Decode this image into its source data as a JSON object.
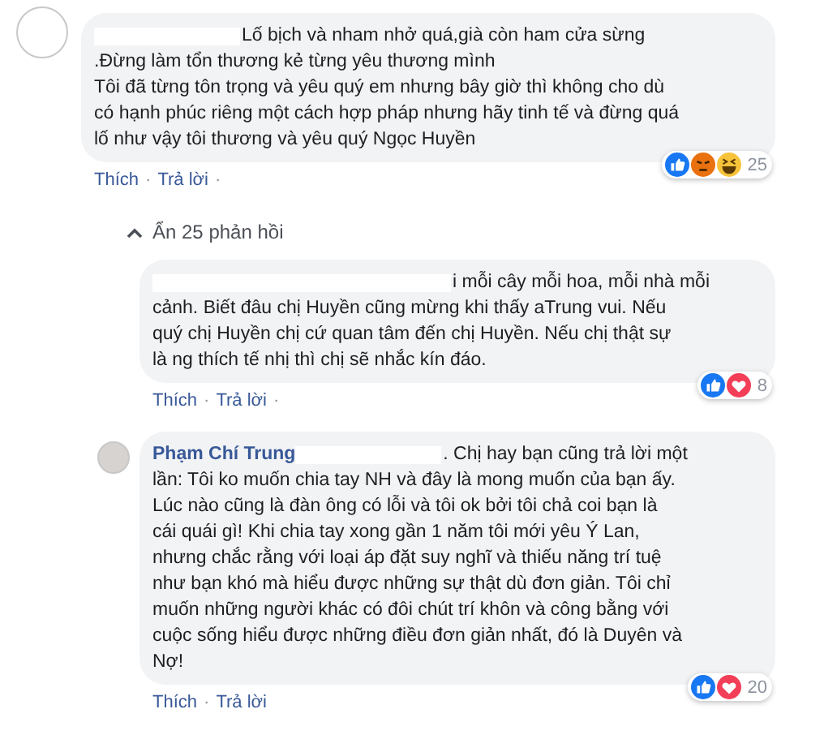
{
  "comments": [
    {
      "kind": "top",
      "lines": [
        "Lố bịch và nham nhở quá,già còn ham cửa sừng",
        ".Đừng làm tổn thương kẻ từng yêu thương mình",
        "Tôi đã từng tôn trọng và yêu quý em nhưng bây giờ thì không cho dù",
        "có hạnh phúc riêng một cách hợp pháp nhưng hãy tinh tế và đừng quá",
        "lố như vậy tôi thương và yêu quý Ngọc Huyền"
      ],
      "actions": [
        "Thích",
        "·",
        "Trả lời",
        "·"
      ],
      "reactions": [
        {
          "kind": "like"
        },
        {
          "kind": "angry"
        },
        {
          "kind": "haha"
        }
      ],
      "reaction_count": "25"
    },
    {
      "kind": "reply",
      "lines": [
        "i mỗi cây mỗi hoa, mỗi nhà mỗi",
        "cảnh. Biết đâu chị Huyền cũng mừng khi thấy aTrung vui. Nếu",
        "quý chị Huyền chị cứ quan tâm đến chị Huyền. Nếu chị thật sự",
        "là ng thích tế nhị thì chị sẽ nhắc kín đáo."
      ],
      "actions": [
        "Thích",
        "·",
        "Trả lời",
        "·"
      ],
      "reactions": [
        {
          "kind": "like"
        },
        {
          "kind": "love"
        }
      ],
      "reaction_count": "8"
    },
    {
      "kind": "reply_with_avatar",
      "author": "Phạm Chí Trung",
      "lines": [
        ". Chị hay bạn cũng trả lời một",
        "lần: Tôi ko muốn chia tay NH và đây là mong muốn của bạn ấy.",
        "Lúc nào cũng là đàn ông có lỗi và tôi ok bởi tôi chả coi bạn là",
        "cái quái gì! Khi chia tay xong gần 1 năm tôi mới yêu Ý Lan,",
        "nhưng chắc rằng với loại áp đặt suy nghĩ và thiếu năng trí tuệ",
        "như bạn khó mà hiểu được những sự thật dù đơn giản. Tôi chỉ",
        "muốn những người khác có đôi chút trí khôn và công bằng với",
        "cuộc sống hiểu được những điều đơn giản nhất, đó là Duyên và",
        "Nợ!"
      ],
      "actions": [
        "Thích",
        "·",
        "Trả lời"
      ],
      "reactions": [
        {
          "kind": "like"
        },
        {
          "kind": "love"
        }
      ],
      "reaction_count": "20"
    }
  ],
  "toggle": {
    "label": "Ẩn 25 phản hồi",
    "expanded": true
  }
}
